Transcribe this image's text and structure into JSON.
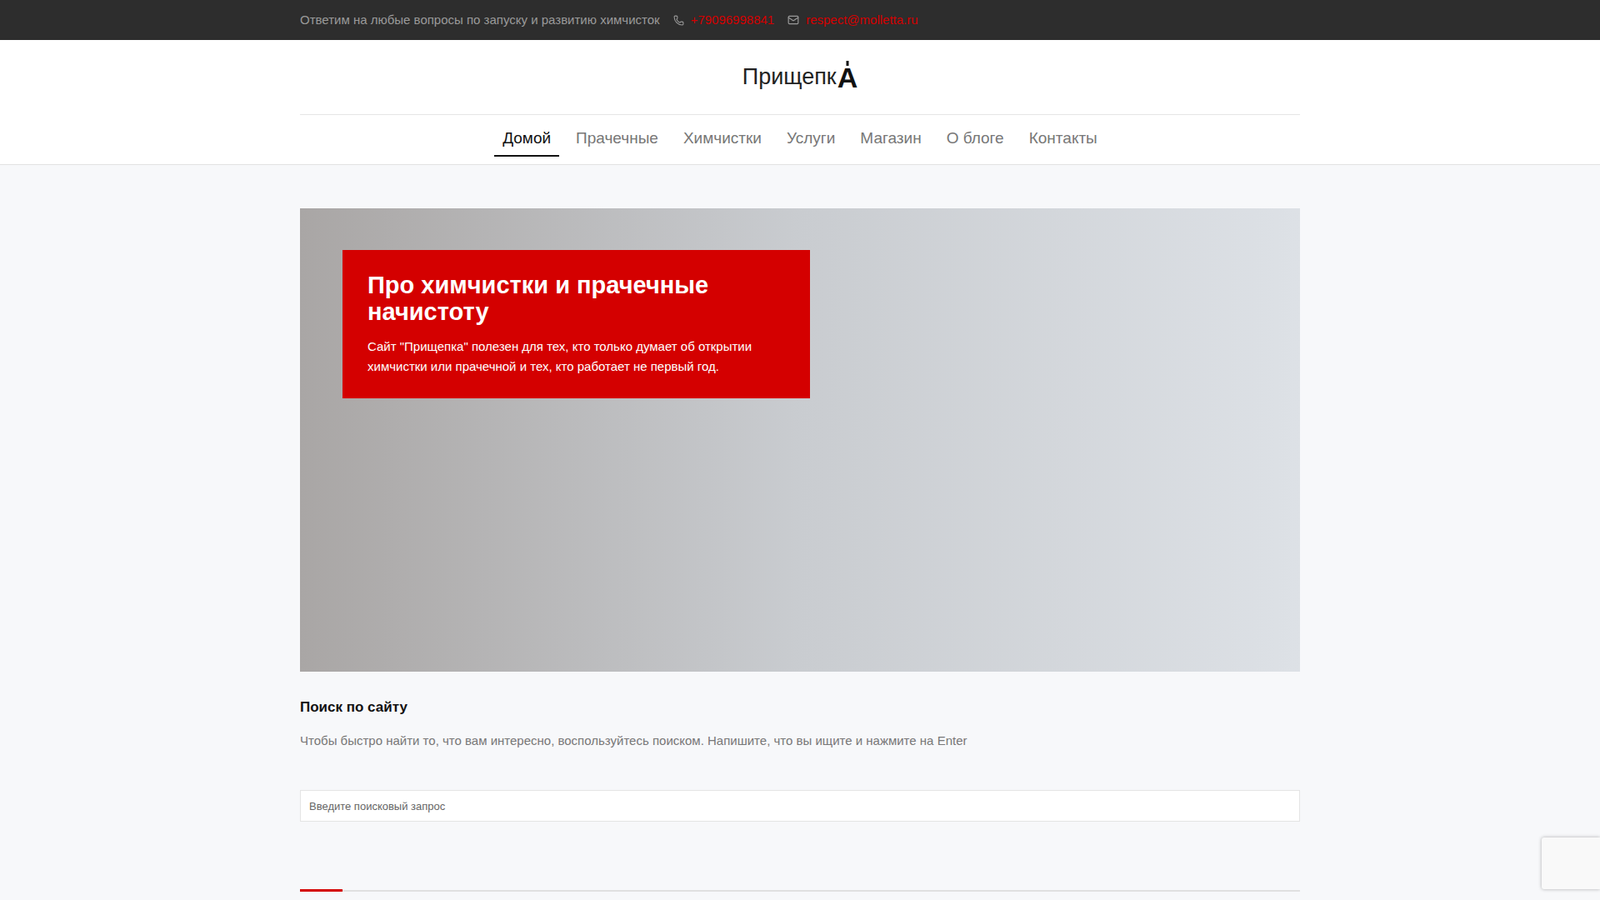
{
  "topbar": {
    "text": "Ответим на любые вопросы по запуску и развитию химчисток",
    "phone": "+79096998841",
    "email": "respect@molletta.ru"
  },
  "logo": {
    "text": "Прищепк",
    "mark": "А"
  },
  "nav": [
    {
      "label": "Домой",
      "selected": true
    },
    {
      "label": "Прачечные",
      "selected": false
    },
    {
      "label": "Химчистки",
      "selected": false
    },
    {
      "label": "Услуги",
      "selected": false
    },
    {
      "label": "Магазин",
      "selected": false
    },
    {
      "label": "О блоге",
      "selected": false
    },
    {
      "label": "Контакты",
      "selected": false
    }
  ],
  "hero": {
    "title": "Про химчистки и прачечные начистоту",
    "text": "Сайт \"Прищепка\" полезен для тех, кто только думает об открытии химчистки или прачечной и тех, кто работает не первый год."
  },
  "search": {
    "title": "Поиск по сайту",
    "description": "Чтобы быстро найти то, что вам интересно, воспользуйтесь поиском. Напишите, что вы ищите и нажмите на Enter",
    "placeholder": "Введите поисковый запрос"
  }
}
